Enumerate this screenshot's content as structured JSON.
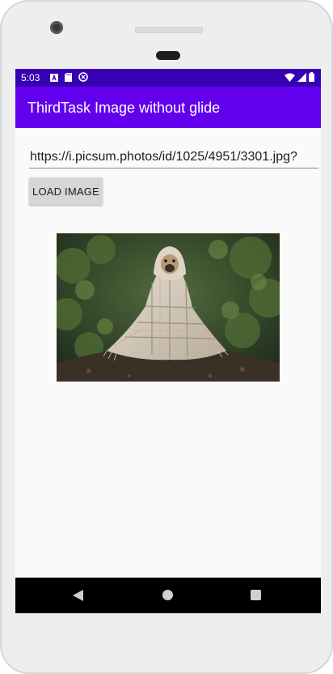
{
  "status_bar": {
    "time": "5:03",
    "left_icons": [
      "a-notification-icon",
      "sd-card-icon",
      "sync-icon"
    ],
    "right_icons": [
      "wifi-icon",
      "signal-icon",
      "battery-icon"
    ],
    "color": "#3700b3"
  },
  "app_bar": {
    "title": "ThirdTask Image without glide",
    "color": "#6200ee"
  },
  "url_input": {
    "value": "https://i.picsum.photos/id/1025/4951/3301.jpg?"
  },
  "load_button": {
    "label": "LOAD IMAGE"
  },
  "image": {
    "subject": "pug-wrapped-in-plaid-blanket-photo"
  },
  "nav_bar": {
    "icons": [
      "back-icon",
      "home-icon",
      "recents-icon"
    ]
  }
}
